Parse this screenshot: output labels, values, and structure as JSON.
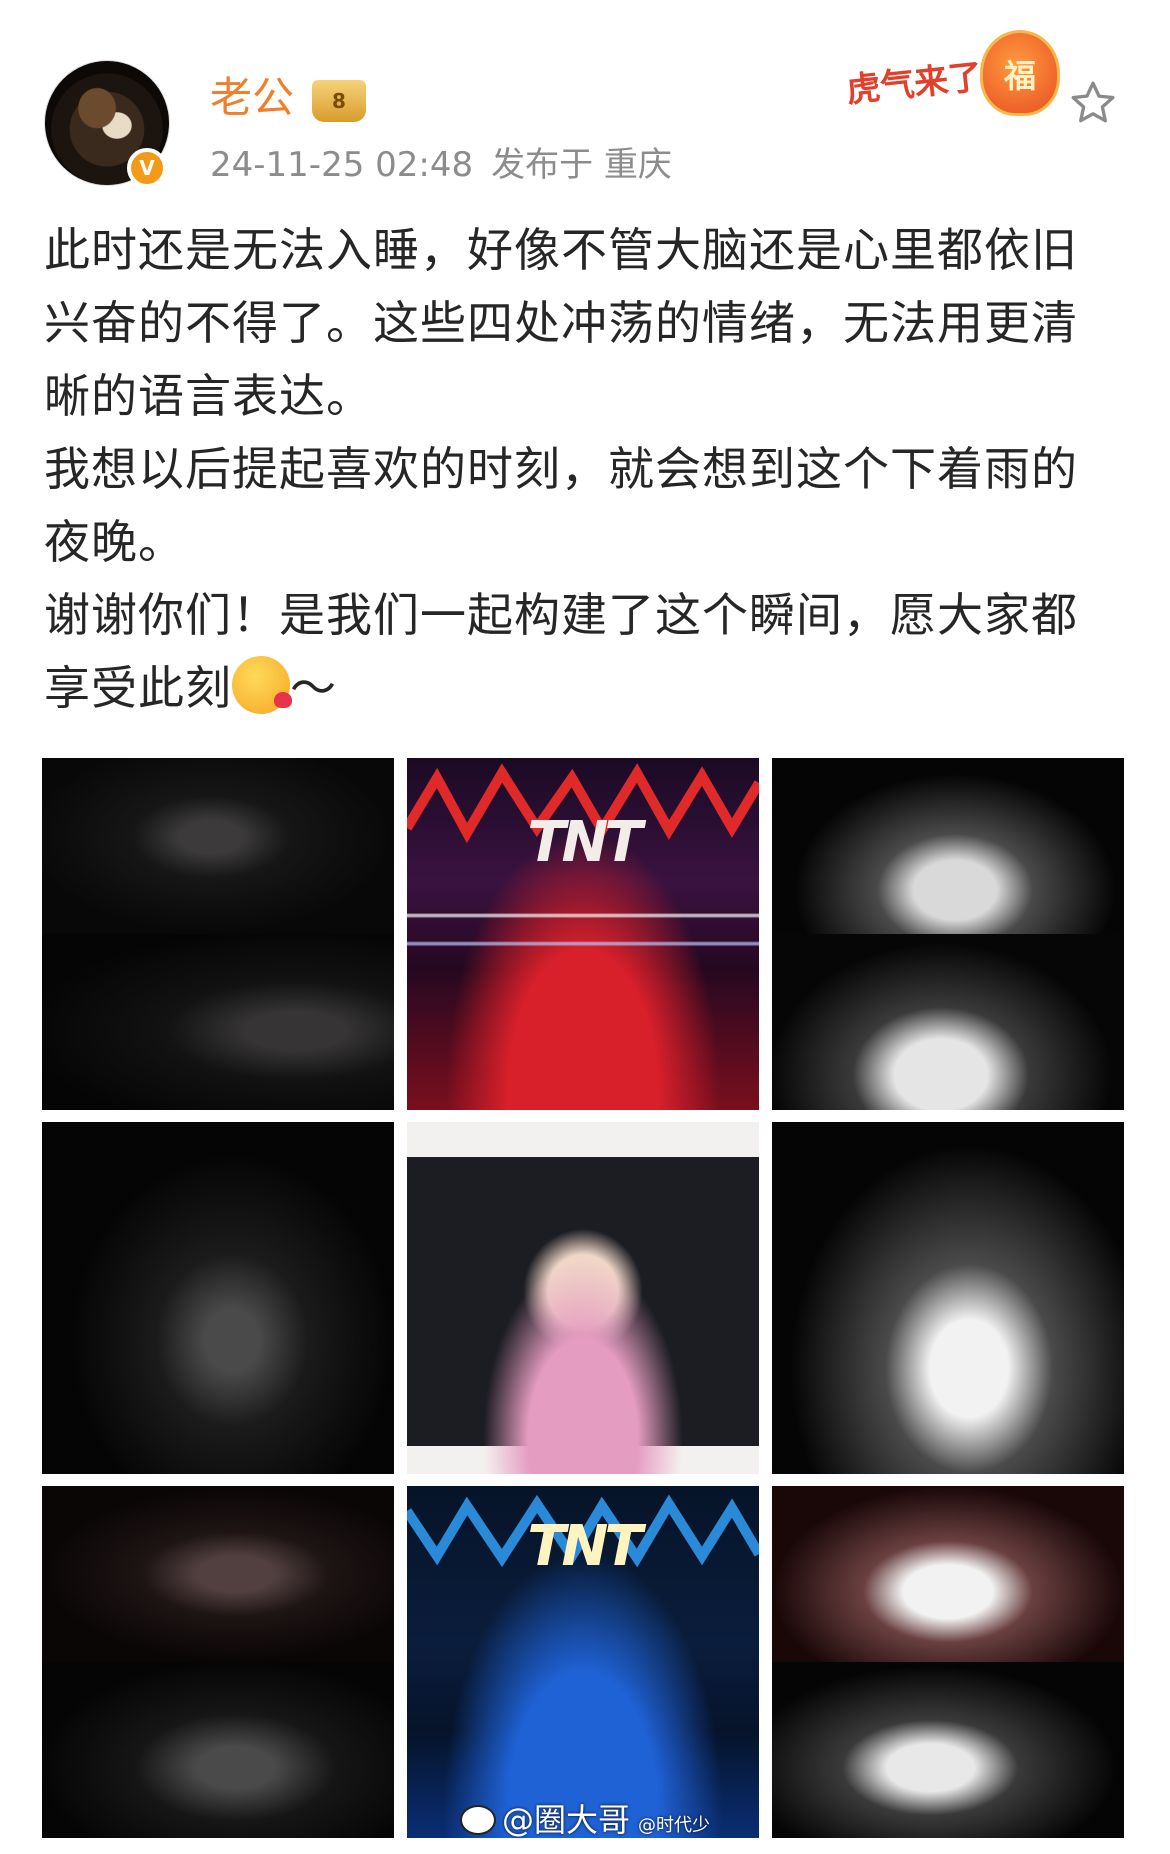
{
  "post": {
    "author": "老公",
    "timestamp": "24-11-25 02:48",
    "source": "发布于 重庆",
    "paragraphs": [
      "此时还是无法入睡，好像不管大脑还是心里都依旧兴奋的不得了。这些四处冲荡的情绪，无法用更清晰的语言表达。",
      "我想以后提起喜欢的时刻，就会想到这个下着雨的夜晚。",
      "谢谢你们！是我们一起构建了这个瞬间，愿大家都享受此刻"
    ],
    "last_line_suffix": "～"
  },
  "promo": {
    "text": "虎气来了",
    "badge": "福"
  },
  "badges": {
    "verified": "V",
    "crown": "8"
  },
  "images": {
    "logo_text": "TNT"
  },
  "watermark": {
    "main": "@圈大哥",
    "secondary": "@时代少"
  },
  "icons": {
    "star": "star-outline-icon",
    "verified": "verified-badge-icon",
    "crown": "vip-crown-icon",
    "weibo": "weibo-logo-icon",
    "emoji": "kissing-face-emoji-icon"
  },
  "colors": {
    "username": "#f07e2a",
    "meta": "#8c8c8c",
    "text": "#262626",
    "verified": "#f39a18"
  }
}
